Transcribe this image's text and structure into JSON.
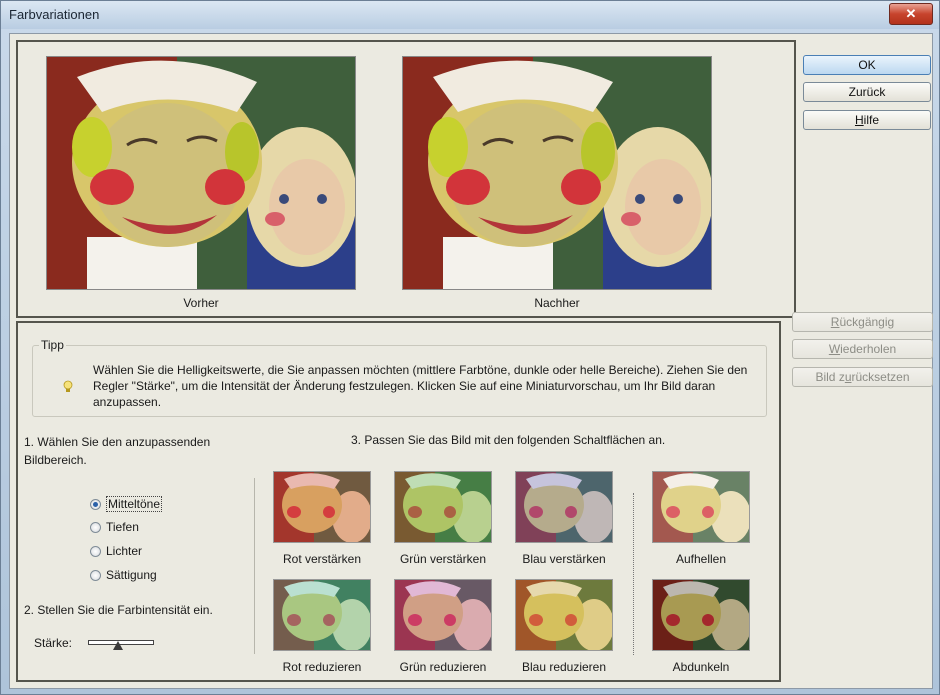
{
  "window": {
    "title": "Farbvariationen",
    "close_glyph": "✕"
  },
  "preview": {
    "before_label": "Vorher",
    "after_label": "Nachher"
  },
  "side_buttons": {
    "ok": "OK",
    "back": "Zurück",
    "help": "Hilfe",
    "undo": "Rückgängig",
    "redo": "Wiederholen",
    "reset": "Bild zurücksetzen"
  },
  "tip": {
    "legend": "Tipp",
    "text": "Wählen Sie die Helligkeitswerte, die Sie anpassen möchten (mittlere Farbtöne, dunkle oder helle Bereiche). Ziehen Sie den Regler \"Stärke\", um die Intensität der Änderung festzulegen. Klicken Sie auf eine Miniaturvorschau, um Ihr Bild daran anzupassen.",
    "icon": "lightbulb-icon"
  },
  "step1": {
    "label": "1. Wählen Sie den anzupassenden Bildbereich.",
    "options": [
      "Mitteltöne",
      "Tiefen",
      "Lichter",
      "Sättigung"
    ],
    "selected": "Mitteltöne"
  },
  "step2": {
    "label": "2. Stellen Sie die Farbintensität ein.",
    "slider_label": "Stärke:"
  },
  "step3": {
    "label": "3. Passen Sie das Bild mit den folgenden Schaltflächen an.",
    "variations": [
      {
        "label": "Rot verstärken",
        "tint": "#d9504a"
      },
      {
        "label": "Grün verstärken",
        "tint": "#56c25a"
      },
      {
        "label": "Blau verstärken",
        "tint": "#6c73d4"
      },
      {
        "label": "Aufhellen",
        "tint": "#ffffff"
      },
      {
        "label": "Rot reduzieren",
        "tint": "#49c9b2"
      },
      {
        "label": "Grün reduzieren",
        "tint": "#c24fbf"
      },
      {
        "label": "Blau reduzieren",
        "tint": "#d0b342"
      },
      {
        "label": "Abdunkeln",
        "tint": "#000000"
      }
    ]
  },
  "colors": {
    "accent": "#4a7fb5",
    "client_bg": "#ebeae1",
    "frame": "#55554d"
  }
}
